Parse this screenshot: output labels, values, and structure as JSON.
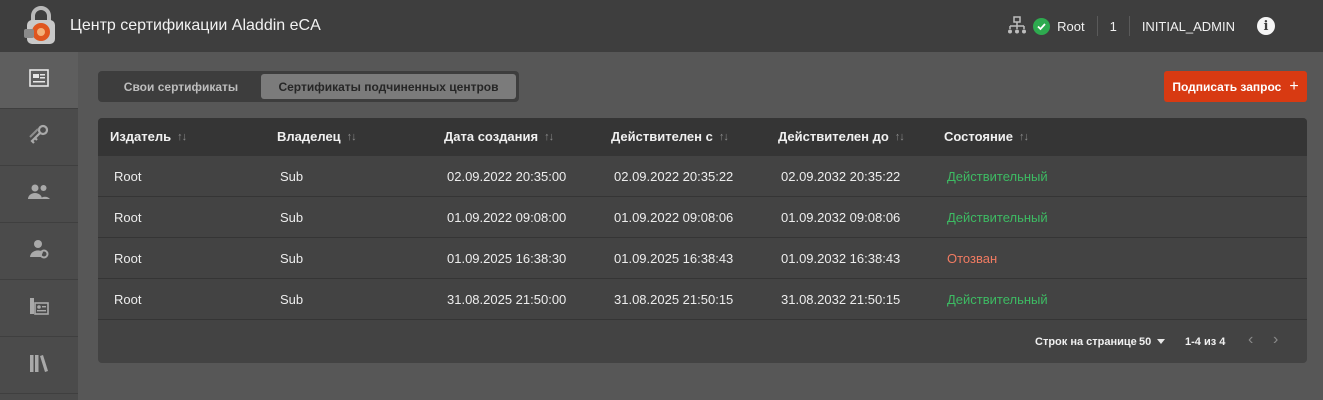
{
  "app": {
    "title": "Центр сертификации Aladdin eCA",
    "user_node": "Root",
    "counter": "1",
    "user_role": "INITIAL_ADMIN"
  },
  "sidebar": {
    "items": [
      {
        "icon": "certificate-card-icon",
        "active": true
      },
      {
        "icon": "keys-icon",
        "active": false
      },
      {
        "icon": "users-icon",
        "active": false
      },
      {
        "icon": "user-settings-icon",
        "active": false
      },
      {
        "icon": "server-cert-icon",
        "active": false
      },
      {
        "icon": "library-icon",
        "active": false
      }
    ]
  },
  "tabs": {
    "own": "Свои сертификаты",
    "subordinate": "Сертификаты подчиненных центров",
    "selected": "subordinate"
  },
  "actions": {
    "sign_request": "Подписать запрос"
  },
  "table": {
    "headers": {
      "issuer": "Издатель",
      "owner": "Владелец",
      "created": "Дата создания",
      "valid_from": "Действителен с",
      "valid_to": "Действителен до",
      "status": "Состояние"
    },
    "rows": [
      {
        "issuer": "Root",
        "owner": "Sub",
        "created": "02.09.2022 20:35:00",
        "valid_from": "02.09.2022 20:35:22",
        "valid_to": "02.09.2032 20:35:22",
        "status": "Действительный",
        "status_kind": "valid"
      },
      {
        "issuer": "Root",
        "owner": "Sub",
        "created": "01.09.2022 09:08:00",
        "valid_from": "01.09.2022 09:08:06",
        "valid_to": "01.09.2032 09:08:06",
        "status": "Действительный",
        "status_kind": "valid"
      },
      {
        "issuer": "Root",
        "owner": "Sub",
        "created": "01.09.2025 16:38:30",
        "valid_from": "01.09.2025 16:38:43",
        "valid_to": "01.09.2032 16:38:43",
        "status": "Отозван",
        "status_kind": "revoked"
      },
      {
        "issuer": "Root",
        "owner": "Sub",
        "created": "31.08.2025 21:50:00",
        "valid_from": "31.08.2025 21:50:15",
        "valid_to": "31.08.2032 21:50:15",
        "status": "Действительный",
        "status_kind": "valid"
      }
    ]
  },
  "pagination": {
    "rows_per_page_label": "Строк на странице",
    "rows_per_page": "50",
    "range": "1-4 из 4"
  },
  "colors": {
    "accent": "#d83a12",
    "status_valid": "#3dbb63",
    "status_revoked": "#f07b62"
  }
}
